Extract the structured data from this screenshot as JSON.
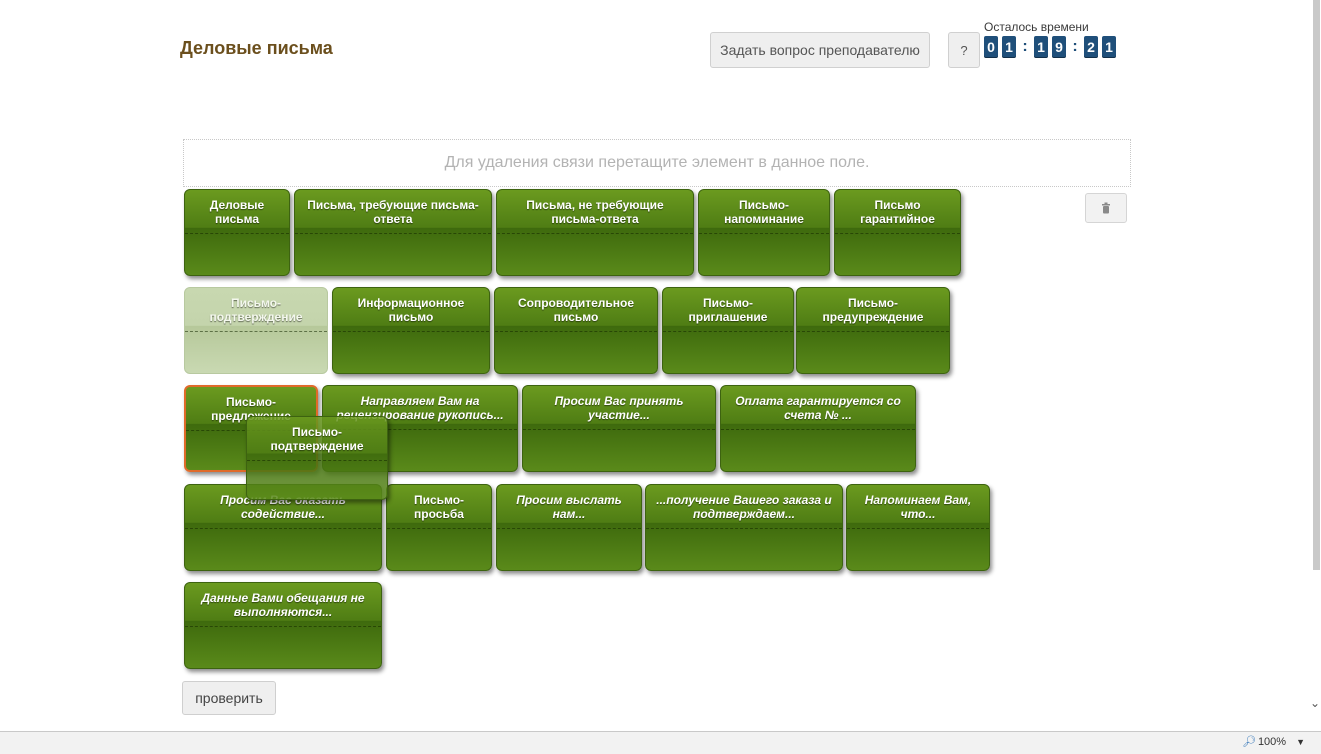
{
  "header": {
    "title": "Деловые письма",
    "ask_button": "Задать вопрос преподавателю",
    "help_button": "?",
    "timer_label": "Осталось времени",
    "timer_digits": [
      "0",
      "1",
      "1",
      "9",
      "2",
      "1"
    ],
    "timer_separator": ":"
  },
  "dropzone_text": "Для удаления связи перетащите элемент в данное поле.",
  "trash_icon": "trash-icon",
  "tiles": [
    {
      "text": "Деловые письма"
    },
    {
      "text": "Письма, требующие письма-ответа"
    },
    {
      "text": "Письма, не требующие письма-ответа"
    },
    {
      "text": "Письмо-напоминание"
    },
    {
      "text": "Письмо гарантийное"
    },
    {
      "text": "Письмо-подтверждение"
    },
    {
      "text": "Информационное письмо"
    },
    {
      "text": "Сопроводительное письмо"
    },
    {
      "text": "Письмо-приглашение"
    },
    {
      "text": "Письмо-предупреждение"
    },
    {
      "text": "Письмо-предложение"
    },
    {
      "text": "Направляем Вам на рецензирование рукопись..."
    },
    {
      "text": "Просим Вас принять участие..."
    },
    {
      "text": "Оплата гарантируется со счета № ..."
    },
    {
      "text": "Просим Вас оказать содействие..."
    },
    {
      "text": "Письмо-просьба"
    },
    {
      "text": "Просим выслать нам..."
    },
    {
      "text": "...получение Вашего заказа и подтверждаем..."
    },
    {
      "text": "Напоминаем Вам, что..."
    },
    {
      "text": "Данные Вами обещания не выполняются..."
    }
  ],
  "dragging_tile": {
    "text": "Письмо-подтверждение"
  },
  "check_button": "проверить",
  "statusbar": {
    "zoom": "100%"
  },
  "colors": {
    "tile_green": "#4f7d14",
    "timer_blue": "#1f4f7a",
    "title_brown": "#6b4f1d",
    "selected_border": "#e06a2a"
  }
}
